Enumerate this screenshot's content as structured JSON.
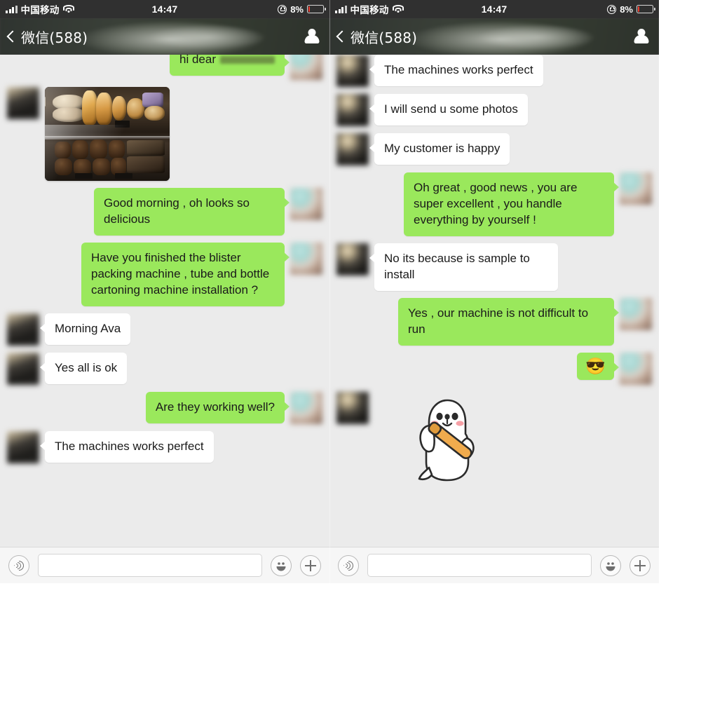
{
  "app": {
    "name": "WeChat",
    "accent_green": "#9ae85c",
    "chat_background": "#ebebeb",
    "incoming_bubble": "#ffffff",
    "statusbar_background": "#303030",
    "navbar_background": "#3c3c3c"
  },
  "status_bar": {
    "carrier": "中国移动",
    "signal_icon": "signal-bars-icon",
    "wifi_icon": "wifi-icon",
    "time": "14:47",
    "rotation_lock_icon": "rotation-lock-icon",
    "battery_percent": "8%",
    "battery_level": 8,
    "battery_icon": "battery-low-icon",
    "battery_color": "#f03a2e"
  },
  "nav_bar": {
    "back_icon": "chevron-left-icon",
    "title": "微信(588)",
    "contact_icon": "person-icon"
  },
  "input_bar": {
    "voice_icon": "voice-input-icon",
    "text_field_value": "",
    "text_field_placeholder": "",
    "emoji_icon": "smiley-face-icon",
    "more_icon": "plus-icon"
  },
  "panels": [
    {
      "id": "left",
      "messages": [
        {
          "type": "text",
          "side": "out",
          "text": "hi dear",
          "clipped": true,
          "redacted_suffix": true,
          "avatar": "light"
        },
        {
          "type": "image",
          "side": "in",
          "caption": "bakery display case with pastries and croissants",
          "avatar": "dark"
        },
        {
          "type": "text",
          "side": "out",
          "text": "Good morning , oh looks so delicious",
          "avatar": "light"
        },
        {
          "type": "text",
          "side": "out",
          "text": "Have you finished the blister packing machine , tube and bottle cartoning machine installation ?",
          "avatar": "light"
        },
        {
          "type": "text",
          "side": "in",
          "text": "Morning Ava",
          "avatar": "dark"
        },
        {
          "type": "text",
          "side": "in",
          "text": "Yes all is ok",
          "avatar": "dark"
        },
        {
          "type": "text",
          "side": "out",
          "text": "Are they working well?",
          "avatar": "light"
        },
        {
          "type": "text",
          "side": "in",
          "text": "The machines works perfect",
          "avatar": "dark"
        }
      ]
    },
    {
      "id": "right",
      "messages": [
        {
          "type": "text",
          "side": "in",
          "text": "The machines works perfect",
          "clipped": true,
          "avatar": "dark2"
        },
        {
          "type": "text",
          "side": "in",
          "text": "I will send u some photos",
          "avatar": "dark2"
        },
        {
          "type": "text",
          "side": "in",
          "text": "My customer is happy",
          "avatar": "dark2"
        },
        {
          "type": "text",
          "side": "out",
          "text": "Oh great , good news , you are super excellent , you handle everything by yourself !",
          "avatar": "light"
        },
        {
          "type": "text",
          "side": "in",
          "text": "No its because is sample to install",
          "avatar": "dark2"
        },
        {
          "type": "text",
          "side": "out",
          "text": "Yes , our machine is not difficult to run",
          "avatar": "light"
        },
        {
          "type": "emoji",
          "side": "out",
          "text": "😎",
          "avatar": "light"
        },
        {
          "type": "sticker",
          "side": "in",
          "sticker_name": "white-rabbit-with-baseball-bat-sticker",
          "avatar": "dark2"
        }
      ]
    }
  ]
}
